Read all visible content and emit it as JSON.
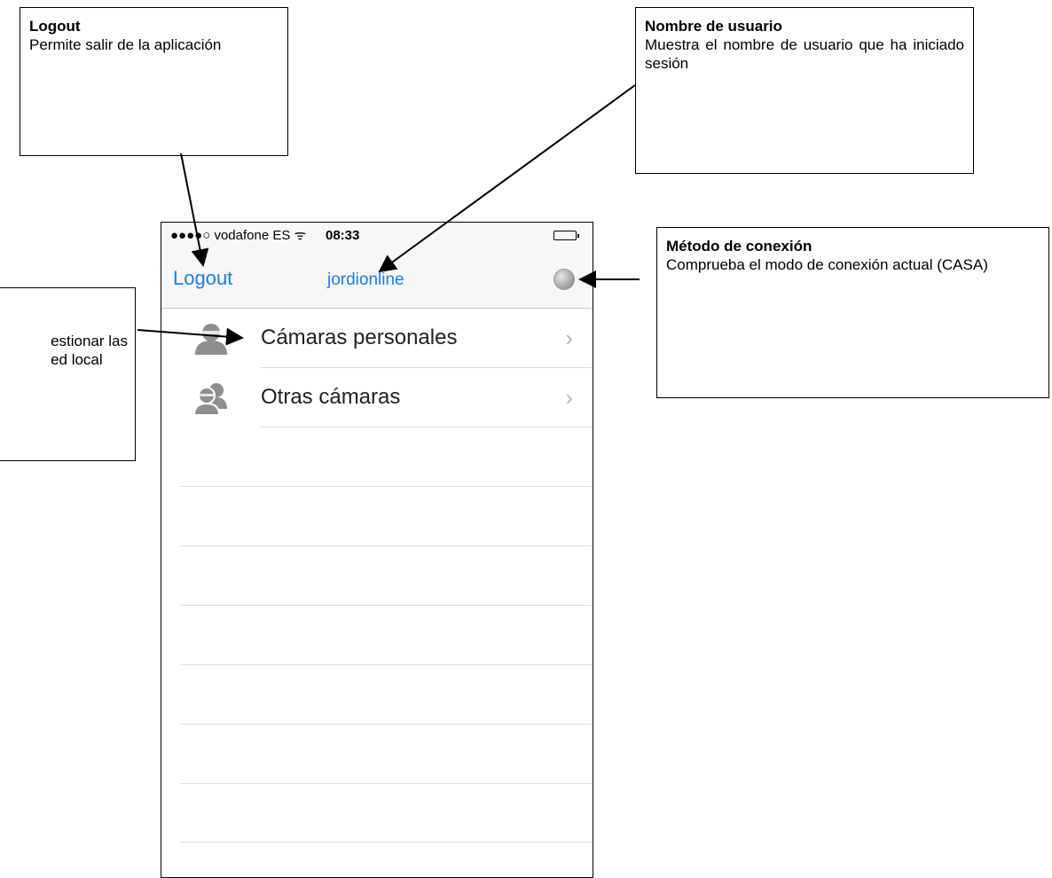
{
  "callouts": {
    "logout": {
      "title": "Logout",
      "desc": "Permite salir de la aplicación"
    },
    "user": {
      "title": "Nombre de usuario",
      "desc": "Muestra el nombre de usuario que ha iniciado sesión"
    },
    "connection": {
      "title": "Método de conexión",
      "desc": "Comprueba el modo de conexión actual (CASA)"
    },
    "cameras": {
      "line1": "estionar las",
      "line2": "ed local"
    }
  },
  "phone": {
    "status": {
      "carrier": "●●●●○ vodafone ES ᯤ",
      "time": "08:33"
    },
    "nav": {
      "left": "Logout",
      "title": "jordionline"
    },
    "rows": [
      {
        "label": "Cámaras personales",
        "icon": "person-icon"
      },
      {
        "label": "Otras cámaras",
        "icon": "people-icon"
      }
    ]
  },
  "colors": {
    "link": "#1a7df0",
    "separator": "#d8d8d8",
    "icon": "#8e8e8e"
  }
}
